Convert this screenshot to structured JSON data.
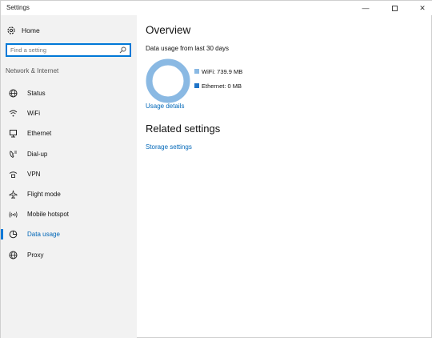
{
  "window": {
    "title": "Settings"
  },
  "titlebar": {
    "minimize": "—",
    "close": "✕"
  },
  "sidebar": {
    "home_label": "Home",
    "search_placeholder": "Find a setting",
    "section_label": "Network & Internet",
    "items": [
      {
        "label": "Status",
        "icon": "globe-icon"
      },
      {
        "label": "WiFi",
        "icon": "wifi-icon"
      },
      {
        "label": "Ethernet",
        "icon": "ethernet-icon"
      },
      {
        "label": "Dial-up",
        "icon": "dial-up-icon"
      },
      {
        "label": "VPN",
        "icon": "vpn-icon"
      },
      {
        "label": "Flight mode",
        "icon": "airplane-icon"
      },
      {
        "label": "Mobile hotspot",
        "icon": "hotspot-icon"
      },
      {
        "label": "Data usage",
        "icon": "data-usage-icon",
        "active": true
      },
      {
        "label": "Proxy",
        "icon": "proxy-globe-icon"
      }
    ]
  },
  "main": {
    "overview_title": "Overview",
    "data_usage_subtitle": "Data usage from last 30 days",
    "legend": [
      {
        "label": "WiFi: 739.9 MB",
        "color": "#8ab9e3"
      },
      {
        "label": "Ethernet: 0 MB",
        "color": "#1f74c8"
      }
    ],
    "usage_details_link": "Usage details",
    "related_title": "Related settings",
    "storage_link": "Storage settings"
  },
  "colors": {
    "accent": "#0078d7",
    "link": "#0067b8",
    "wifi_ring": "#8ab9e3",
    "sidebar_bg": "#f2f2f2"
  },
  "chart_data": {
    "type": "pie",
    "categories": [
      "WiFi",
      "Ethernet"
    ],
    "values": [
      739.9,
      0
    ],
    "unit": "MB"
  }
}
